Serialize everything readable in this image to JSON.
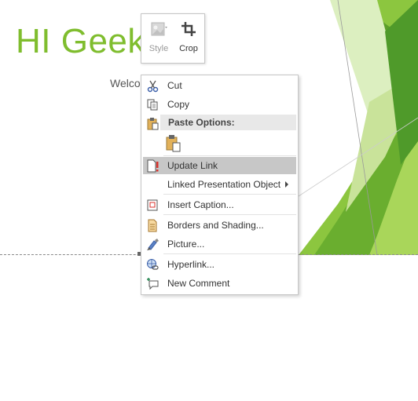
{
  "slide": {
    "title": "HI Geek",
    "subtitle": "Welco"
  },
  "mini_toolbar": {
    "style_label": "Style",
    "crop_label": "Crop"
  },
  "context_menu": {
    "cut": "Cut",
    "copy": "Copy",
    "paste_options": "Paste Options:",
    "update_link": "Update Link",
    "linked_object": "Linked Presentation Object",
    "insert_caption": "Insert Caption...",
    "borders_shading": "Borders and Shading...",
    "picture": "Picture...",
    "hyperlink": "Hyperlink...",
    "new_comment": "New Comment"
  },
  "colors": {
    "title_green": "#7fbd2e",
    "deco_dark": "#5c9e2a",
    "deco_mid": "#8cc63f",
    "deco_light": "#c9e39a",
    "highlight": "#c7c7c7"
  }
}
